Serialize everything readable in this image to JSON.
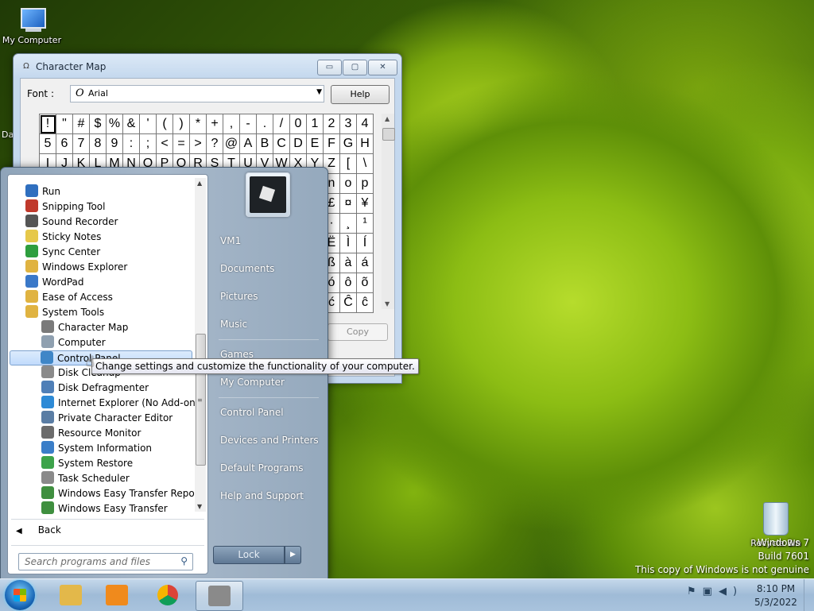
{
  "desktop": {
    "icons": {
      "my_computer": "My Computer",
      "recycle_bin": "Recycle Bin",
      "partial_left": "Da"
    },
    "watermark": {
      "line1": "Windows 7",
      "line2": "Build 7601",
      "line3": "This copy of Windows is not genuine"
    }
  },
  "charmap": {
    "title": "Character Map",
    "font_label": "Font :",
    "font_value": "Arial",
    "font_icon": "O",
    "help_label": "Help",
    "copy_label": "Copy",
    "controls": {
      "minimize": "▭",
      "maximize": "▢",
      "close": "✕"
    },
    "rows": [
      [
        "!",
        "\"",
        "#",
        "$",
        "%",
        "&",
        "'",
        "(",
        ")",
        "*",
        "+",
        ",",
        "-",
        ".",
        "/",
        "0",
        "1",
        "2",
        "3",
        "4"
      ],
      [
        "5",
        "6",
        "7",
        "8",
        "9",
        ":",
        ";",
        "<",
        "=",
        ">",
        "?",
        "@",
        "A",
        "B",
        "C",
        "D",
        "E",
        "F",
        "G",
        "H"
      ],
      [
        "I",
        "J",
        "K",
        "L",
        "M",
        "N",
        "O",
        "P",
        "Q",
        "R",
        "S",
        "T",
        "U",
        "V",
        "W",
        "X",
        "Y",
        "Z",
        "[",
        "\\"
      ],
      [
        "",
        "",
        "",
        "",
        "",
        "",
        "",
        "",
        "",
        "",
        "",
        "",
        "",
        "",
        "",
        "",
        "",
        "n",
        "o",
        "p"
      ],
      [
        "",
        "",
        "",
        "",
        "",
        "",
        "",
        "",
        "",
        "",
        "",
        "",
        "",
        "",
        "",
        "",
        "",
        "£",
        "¤",
        "¥"
      ],
      [
        "",
        "",
        "",
        "",
        "",
        "",
        "",
        "",
        "",
        "",
        "",
        "",
        "",
        "",
        "",
        "",
        "",
        "·",
        "¸",
        "¹"
      ],
      [
        "",
        "",
        "",
        "",
        "",
        "",
        "",
        "",
        "",
        "",
        "",
        "",
        "",
        "",
        "",
        "",
        "",
        "Ë",
        "Ì",
        "Í"
      ],
      [
        "",
        "",
        "",
        "",
        "",
        "",
        "",
        "",
        "",
        "",
        "",
        "",
        "",
        "",
        "",
        "",
        "",
        "ß",
        "à",
        "á"
      ],
      [
        "",
        "",
        "",
        "",
        "",
        "",
        "",
        "",
        "",
        "",
        "",
        "",
        "",
        "",
        "",
        "",
        "",
        "ó",
        "ô",
        "õ"
      ],
      [
        "",
        "",
        "",
        "",
        "",
        "",
        "",
        "",
        "",
        "",
        "",
        "",
        "",
        "",
        "",
        "",
        "",
        "ć",
        "Ĉ",
        "ĉ"
      ]
    ]
  },
  "start_menu": {
    "programs": [
      {
        "label": "Run",
        "icon": "run-icon",
        "color": "#2f6fbf",
        "indent": 0
      },
      {
        "label": "Snipping Tool",
        "icon": "scissors-icon",
        "color": "#c0392b",
        "indent": 0
      },
      {
        "label": "Sound Recorder",
        "icon": "microphone-icon",
        "color": "#555555",
        "indent": 0
      },
      {
        "label": "Sticky Notes",
        "icon": "sticky-note-icon",
        "color": "#e6c84a",
        "indent": 0
      },
      {
        "label": "Sync Center",
        "icon": "sync-icon",
        "color": "#2e9e3e",
        "indent": 0
      },
      {
        "label": "Windows Explorer",
        "icon": "folder-explorer-icon",
        "color": "#e0b341",
        "indent": 0
      },
      {
        "label": "WordPad",
        "icon": "wordpad-icon",
        "color": "#3a78c8",
        "indent": 0
      },
      {
        "label": "Ease of Access",
        "icon": "folder-icon",
        "color": "#e0b341",
        "indent": 0
      },
      {
        "label": "System Tools",
        "icon": "folder-icon",
        "color": "#e0b341",
        "indent": 0
      },
      {
        "label": "Character Map",
        "icon": "charmap-icon",
        "color": "#7a7a7a",
        "indent": 1
      },
      {
        "label": "Computer",
        "icon": "computer-icon",
        "color": "#8fa0b0",
        "indent": 1
      },
      {
        "label": "Control Panel",
        "icon": "control-panel-icon",
        "color": "#3f86c7",
        "indent": 1,
        "highlight": true
      },
      {
        "label": "Disk Cleanup",
        "icon": "disk-cleanup-icon",
        "color": "#8a8a8a",
        "indent": 1
      },
      {
        "label": "Disk Defragmenter",
        "icon": "defrag-icon",
        "color": "#4f7fb7",
        "indent": 1
      },
      {
        "label": "Internet Explorer (No Add-ons)",
        "icon": "ie-icon",
        "color": "#2d8ad6",
        "indent": 1
      },
      {
        "label": "Private Character Editor",
        "icon": "char-editor-icon",
        "color": "#5a7da4",
        "indent": 1
      },
      {
        "label": "Resource Monitor",
        "icon": "monitor-icon",
        "color": "#6b6b6b",
        "indent": 1
      },
      {
        "label": "System Information",
        "icon": "info-icon",
        "color": "#3a7ec8",
        "indent": 1
      },
      {
        "label": "System Restore",
        "icon": "restore-icon",
        "color": "#3ca34a",
        "indent": 1
      },
      {
        "label": "Task Scheduler",
        "icon": "clock-icon",
        "color": "#8a8a8a",
        "indent": 1
      },
      {
        "label": "Windows Easy Transfer Reports",
        "icon": "transfer-reports-icon",
        "color": "#3f8f3f",
        "indent": 1
      },
      {
        "label": "Windows Easy Transfer",
        "icon": "transfer-icon",
        "color": "#3f8f3f",
        "indent": 1
      }
    ],
    "back_label": "Back",
    "search_placeholder": "Search programs and files",
    "right_items": [
      {
        "label": "VM1",
        "name": "user-name-link"
      },
      {
        "label": "Documents",
        "name": "documents-link"
      },
      {
        "label": "Pictures",
        "name": "pictures-link"
      },
      {
        "label": "Music",
        "name": "music-link"
      },
      {
        "label": "Games",
        "name": "games-link"
      },
      {
        "label": "My Computer",
        "name": "my-computer-link"
      },
      {
        "label": "Control Panel",
        "name": "control-panel-link"
      },
      {
        "label": "Devices and Printers",
        "name": "devices-printers-link"
      },
      {
        "label": "Default Programs",
        "name": "default-programs-link"
      },
      {
        "label": "Help and Support",
        "name": "help-support-link"
      }
    ],
    "lock_label": "Lock"
  },
  "tooltip": {
    "text": "Change settings and customize the functionality of your computer."
  },
  "taskbar": {
    "pinned": [
      {
        "name": "explorer-taskbar-button",
        "icon": "folder-explorer-icon",
        "color": "#e3b84a"
      },
      {
        "name": "media-player-taskbar-button",
        "icon": "media-player-icon",
        "color": "#f08a1c"
      },
      {
        "name": "chrome-taskbar-button",
        "icon": "chrome-icon",
        "color": "#db4437"
      },
      {
        "name": "charmap-taskbar-button",
        "icon": "charmap-icon",
        "color": "#8a8a8a",
        "active": true
      }
    ],
    "time": "8:10 PM",
    "date": "5/3/2022"
  }
}
